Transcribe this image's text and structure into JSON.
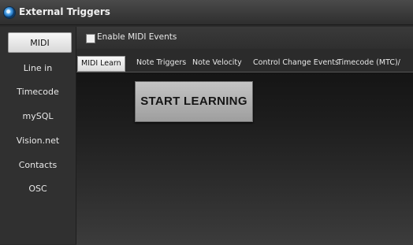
{
  "window": {
    "title": "External Triggers",
    "icon": "app-globe-icon"
  },
  "sidebar": {
    "items": [
      {
        "label": "MIDI",
        "active": true
      },
      {
        "label": "Line in"
      },
      {
        "label": "Timecode"
      },
      {
        "label": "mySQL"
      },
      {
        "label": "Vision.net"
      },
      {
        "label": "Contacts"
      },
      {
        "label": "OSC"
      }
    ]
  },
  "options": {
    "enable_midi_label": "Enable MIDI Events",
    "enable_midi_checked": false
  },
  "tabs": [
    {
      "label": "MIDI Learn",
      "active": true
    },
    {
      "label": "Note Triggers"
    },
    {
      "label": "Note Velocity"
    },
    {
      "label": "Control Change Events"
    },
    {
      "label": "Timecode (MTC)/"
    }
  ],
  "main": {
    "start_button_label": "START LEARNING"
  }
}
